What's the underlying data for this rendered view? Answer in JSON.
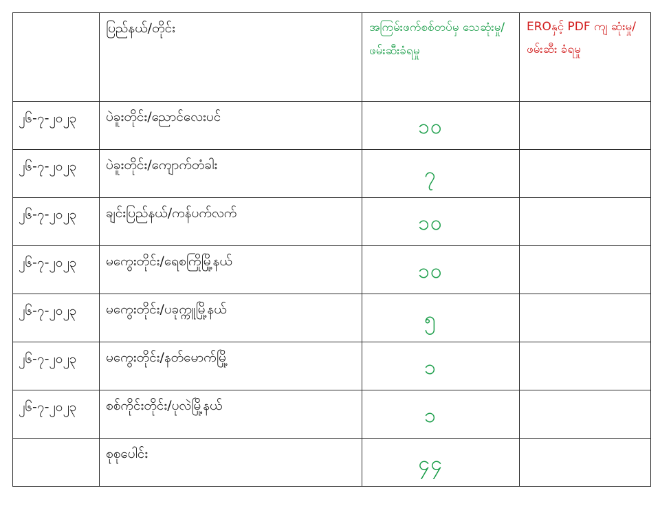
{
  "header": {
    "date": "",
    "place": "ပြည်နယ်/တိုင်း",
    "count": "အကြမ်းဖက်စစ်တပ်မှ သေဆုံးမှု/ ဖမ်းဆီးခံရမှု",
    "ero": "EROနှင့် PDF ကျ ဆုံးမှု/ ဖမ်းဆီး ခံရမှု"
  },
  "rows": [
    {
      "date": "၂၆-၇-၂၀၂၃",
      "place": "ပဲခူးတိုင်း/ညောင်လေးပင်",
      "count": "၁၀",
      "ero": ""
    },
    {
      "date": "၂၆-၇-၂၀၂၃",
      "place": "ပဲခူးတိုင်း/ကျောက်တံခါး",
      "count": "၇",
      "ero": ""
    },
    {
      "date": "၂၆-၇-၂၀၂၃",
      "place": "ချင်းပြည်နယ်/ကန်ပက်လက်",
      "count": "၁၀",
      "ero": ""
    },
    {
      "date": "၂၆-၇-၂၀၂၃",
      "place": "မကွေးတိုင်း/ရေစကြိုမြို့နယ်",
      "count": "၁၀",
      "ero": ""
    },
    {
      "date": "၂၆-၇-၂၀၂၃",
      "place": "မကွေးတိုင်း/ပခုက္ကူမြို့နယ်",
      "count": "၅",
      "ero": ""
    },
    {
      "date": "၂၆-၇-၂၀၂၃",
      "place": "မကွေးတိုင်း/နတ်မောက်မြို့",
      "count": "၁",
      "ero": ""
    },
    {
      "date": "၂၆-၇-၂၀၂၃",
      "place": "စစ်ကိုင်းတိုင်း/ပုလဲမြို့နယ်",
      "count": "၁",
      "ero": ""
    }
  ],
  "total": {
    "date": "",
    "label": "စုစုပေါင်း",
    "count": "၄၄",
    "ero": ""
  },
  "colors": {
    "count": "#1c9e4a",
    "ero_header": "#d11b1b",
    "border": "#2a2a2a"
  }
}
